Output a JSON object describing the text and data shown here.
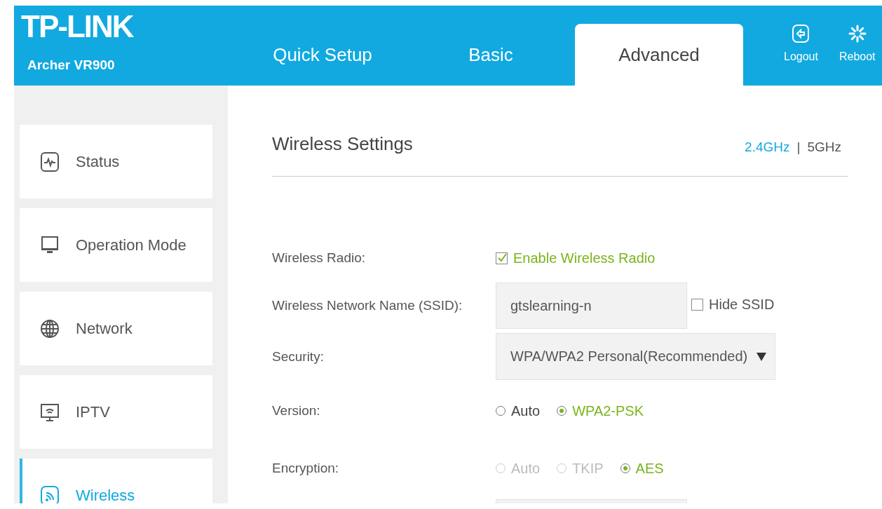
{
  "header": {
    "logo": "TP-LINK",
    "model": "Archer VR900",
    "tabs": [
      {
        "label": "Quick Setup",
        "selected": false
      },
      {
        "label": "Basic",
        "selected": false
      },
      {
        "label": "Advanced",
        "selected": true
      }
    ],
    "actions": [
      {
        "label": "Logout",
        "kind": "logout"
      },
      {
        "label": "Reboot",
        "kind": "reboot"
      }
    ]
  },
  "sidebar": {
    "items": [
      {
        "label": "Status",
        "kind": "status",
        "selected": false
      },
      {
        "label": "Operation Mode",
        "kind": "monitor",
        "selected": false
      },
      {
        "label": "Network",
        "kind": "globe",
        "selected": false
      },
      {
        "label": "IPTV",
        "kind": "tv",
        "selected": false
      },
      {
        "label": "Wireless",
        "kind": "wireless",
        "selected": true
      }
    ]
  },
  "content": {
    "title": "Wireless Settings",
    "separator": "|",
    "bands": [
      {
        "label": "2.4GHz",
        "selected": true
      },
      {
        "label": "5GHz",
        "selected": false
      }
    ],
    "fields": [
      {
        "kind": "checkbox",
        "label": "Wireless Radio:",
        "option": "Enable Wireless Radio",
        "checked": true
      },
      {
        "kind": "text",
        "label": "Wireless Network Name (SSID):",
        "value": "gtslearning-n",
        "extra": {
          "label": "Hide SSID",
          "checked": false
        }
      },
      {
        "kind": "select",
        "label": "Security:",
        "value": "WPA/WPA2 Personal(Recommended)"
      },
      {
        "kind": "radio",
        "label": "Version:",
        "options": [
          {
            "label": "Auto",
            "selected": false,
            "disabled": false
          },
          {
            "label": "WPA2-PSK",
            "selected": true,
            "disabled": false
          }
        ]
      },
      {
        "kind": "radio",
        "label": "Encryption:",
        "options": [
          {
            "label": "Auto",
            "selected": false,
            "disabled": true
          },
          {
            "label": "TKIP",
            "selected": false,
            "disabled": true
          },
          {
            "label": "AES",
            "selected": true,
            "disabled": false
          }
        ]
      },
      {
        "kind": "input"
      }
    ]
  }
}
